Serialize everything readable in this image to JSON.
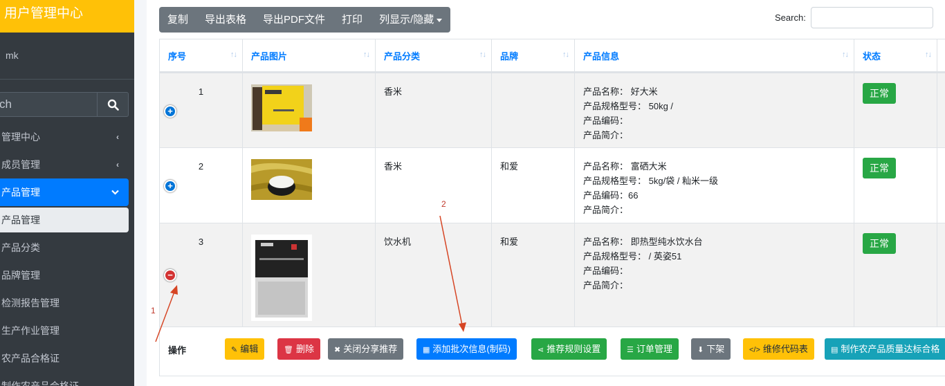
{
  "sidebar": {
    "brand": "用户管理中心",
    "user": "mk",
    "search_placeholder": "Search",
    "search_value": "ch",
    "items": [
      {
        "label": "管理中心",
        "icon": "chevron-left-icon"
      },
      {
        "label": "成员管理",
        "icon": "chevron-left-icon"
      },
      {
        "label": "产品管理",
        "icon": "chevron-down-icon"
      },
      {
        "label": "产品管理"
      },
      {
        "label": "产品分类"
      },
      {
        "label": "品牌管理"
      },
      {
        "label": "检测报告管理"
      },
      {
        "label": "生产作业管理"
      },
      {
        "label": "农产品合格证"
      },
      {
        "label": "制作农产品合格证"
      }
    ]
  },
  "toolbar": {
    "buttons": [
      "复制",
      "导出表格",
      "导出PDF文件",
      "打印",
      "列显示/隐藏"
    ],
    "search_label": "Search:"
  },
  "table": {
    "headers": [
      "序号",
      "产品图片",
      "产品分类",
      "品牌",
      "产品信息",
      "状态"
    ],
    "rows": [
      {
        "seq": "1",
        "category": "香米",
        "brand": "",
        "info": [
          "产品名称： 好大米",
          "产品规格型号： 50kg /",
          "产品编码：",
          "产品简介："
        ],
        "status": "正常"
      },
      {
        "seq": "2",
        "category": "香米",
        "brand": "和爱",
        "info": [
          "产品名称： 富硒大米",
          "产品规格型号： 5kg/袋 / 籼米一级",
          "产品编码：66",
          "产品简介："
        ],
        "status": "正常"
      },
      {
        "seq": "3",
        "category": "饮水机",
        "brand": "和爱",
        "info": [
          "产品名称： 即热型纯水饮水台",
          "产品规格型号： / 英姿51",
          "产品编码：",
          "产品简介："
        ],
        "status": "正常"
      }
    ]
  },
  "ops": {
    "label": "操作",
    "buttons": [
      "编辑",
      "删除",
      "关闭分享推荐",
      "添加批次信息(制码)",
      "推荐规则设置",
      "订单管理",
      "下架",
      "维修代码表",
      "制作农产品质量达标合格"
    ]
  },
  "annotations": [
    "1",
    "2"
  ],
  "colors": {
    "brand": "#ffc107",
    "sidebar": "#343a40",
    "primary": "#007bff",
    "success": "#28a745",
    "danger": "#dc3545",
    "annotation": "#c0392b"
  }
}
